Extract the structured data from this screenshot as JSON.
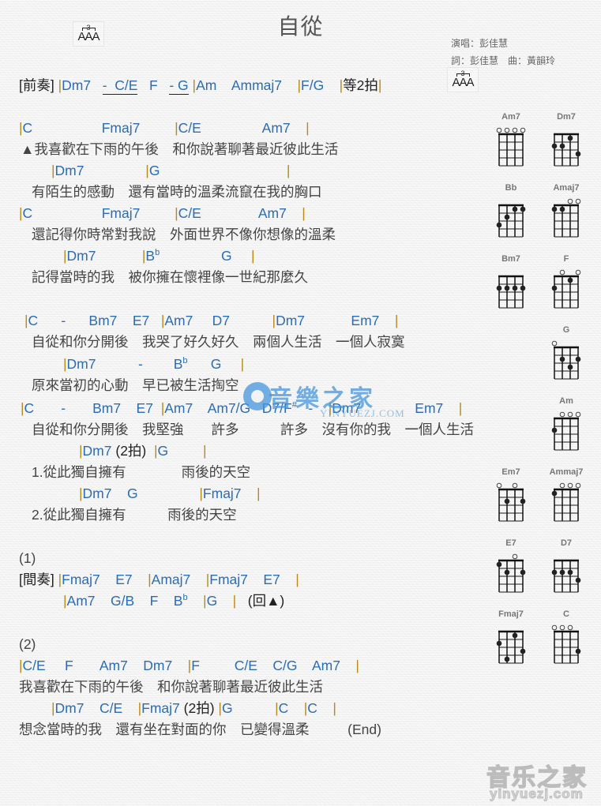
{
  "header": {
    "title": "自從",
    "symbol_three": "3",
    "symbol_aaa": "AAA",
    "singer": "演唱：彭佳慧",
    "writers": "詞：彭佳慧　曲：黃韻玲"
  },
  "intro": {
    "label": "[前奏]",
    "chords": [
      "Dm7",
      "-",
      "C/E",
      "F",
      "-",
      "G",
      "Am",
      "Ammaj7",
      "F/G"
    ],
    "wait": "等2拍"
  },
  "verse1": {
    "lines": [
      {
        "chords": [
          "C",
          "Fmaj7",
          "C/E",
          "Am7"
        ],
        "lyric": "▲我喜歡在下雨的午後　和你說著聊著最近彼此生活"
      },
      {
        "chords": [
          "Dm7",
          "G"
        ],
        "lyric": "有陌生的感動　還有當時的溫柔流竄在我的胸口"
      },
      {
        "chords": [
          "C",
          "Fmaj7",
          "C/E",
          "Am7"
        ],
        "lyric": "還記得你時常對我說　外面世界不像你想像的溫柔"
      },
      {
        "chords": [
          "Dm7",
          "B",
          "G"
        ],
        "chord_sup": "b",
        "lyric": "記得當時的我　被你擁在懷裡像一世紀那麼久"
      }
    ]
  },
  "chorus": {
    "lines": [
      {
        "chords": [
          "C",
          "-",
          "Bm7",
          "E7",
          "Am7",
          "D7",
          "Dm7",
          "Em7"
        ],
        "lyric": "自從和你分開後　我哭了好久好久　兩個人生活　一個人寂寞"
      },
      {
        "chords": [
          "Dm7",
          "-",
          "B",
          "G"
        ],
        "chord_sup": "b",
        "lyric": "原來當初的心動　早已被生活掏空"
      },
      {
        "chords": [
          "C",
          "-",
          "Bm7",
          "E7",
          "Am7",
          "Am7/G",
          "D7/F",
          "-",
          "Dm7",
          "Em7"
        ],
        "chord_sup": "#",
        "lyric_parts": [
          "自從和你分開後",
          "我堅強",
          "許多",
          "許多",
          "沒有你的我",
          "一個人生活"
        ]
      },
      {
        "chords": [
          "Dm7",
          "G"
        ],
        "beat": "(2拍)",
        "lyric_parts": [
          "1.從此獨自擁有",
          "雨後的天空"
        ]
      },
      {
        "chords": [
          "Dm7",
          "G",
          "Fmaj7"
        ],
        "lyric_parts": [
          "2.從此獨自擁有",
          "雨後的天空"
        ]
      }
    ]
  },
  "interlude": {
    "marker": "(1)",
    "label": "[間奏]",
    "line1": [
      "Fmaj7",
      "E7",
      "Amaj7",
      "Fmaj7",
      "E7"
    ],
    "line2": [
      "Am7",
      "G/B",
      "F",
      "B",
      "G"
    ],
    "line2_sup": "b",
    "back": "(回▲)"
  },
  "ending": {
    "marker": "(2)",
    "line1_chords": [
      "C/E",
      "F",
      "Am7",
      "Dm7",
      "F",
      "C/E",
      "C/G",
      "Am7"
    ],
    "line1_lyric": "我喜歡在下雨的午後　和你說著聊著最近彼此生活",
    "line2_chords": [
      "Dm7",
      "C/E",
      "Fmaj7",
      "G",
      "C",
      "C"
    ],
    "line2_beat": "(2拍)",
    "line2_lyric": "想念當時的我　還有坐在對面的你　已變得溫柔",
    "end": "(End)"
  },
  "watermark": {
    "cn": "音樂之家",
    "en": "YINYUEZJ.COM"
  },
  "footer_logo": {
    "cn": "音乐之家",
    "en": "yinyuezj.com"
  },
  "chord_diagrams": [
    {
      "name": "Am7",
      "open": [
        1,
        1,
        1,
        1
      ],
      "dots": []
    },
    {
      "name": "Dm7",
      "open": [
        0,
        0,
        0,
        0
      ],
      "dots": [
        [
          1,
          2
        ],
        [
          2,
          2
        ],
        [
          3,
          1
        ],
        [
          4,
          3
        ]
      ]
    },
    {
      "name": "Bb",
      "open": [
        0,
        0,
        0,
        0
      ],
      "dots": [
        [
          1,
          3
        ],
        [
          2,
          2
        ],
        [
          3,
          1
        ],
        [
          4,
          1
        ]
      ]
    },
    {
      "name": "Amaj7",
      "open": [
        0,
        0,
        1,
        1
      ],
      "dots": [
        [
          1,
          1
        ],
        [
          2,
          1
        ]
      ]
    },
    {
      "name": "Bm7",
      "open": [
        0,
        0,
        0,
        0
      ],
      "dots": [
        [
          1,
          2
        ],
        [
          2,
          2
        ],
        [
          3,
          2
        ],
        [
          4,
          2
        ]
      ]
    },
    {
      "name": "F",
      "open": [
        0,
        1,
        0,
        1
      ],
      "dots": [
        [
          1,
          2
        ],
        [
          3,
          1
        ]
      ]
    },
    {
      "name": "G",
      "open": [
        1,
        0,
        0,
        0
      ],
      "dots": [
        [
          2,
          2
        ],
        [
          3,
          3
        ],
        [
          4,
          2
        ]
      ]
    },
    {
      "name": "Am",
      "open": [
        0,
        1,
        1,
        1
      ],
      "dots": [
        [
          1,
          2
        ]
      ]
    },
    {
      "name": "Em7",
      "open": [
        1,
        0,
        1,
        0
      ],
      "dots": [
        [
          2,
          2
        ],
        [
          4,
          2
        ]
      ]
    },
    {
      "name": "Ammaj7",
      "open": [
        0,
        1,
        1,
        1
      ],
      "dots": [
        [
          1,
          1
        ]
      ]
    },
    {
      "name": "E7",
      "open": [
        0,
        0,
        1,
        0
      ],
      "dots": [
        [
          1,
          1
        ],
        [
          2,
          2
        ],
        [
          4,
          2
        ]
      ]
    },
    {
      "name": "D7",
      "open": [
        0,
        0,
        0,
        0
      ],
      "dots": [
        [
          1,
          2
        ],
        [
          2,
          2
        ],
        [
          3,
          2
        ],
        [
          4,
          3
        ]
      ]
    },
    {
      "name": "Fmaj7",
      "open": [
        0,
        0,
        0,
        0
      ],
      "dots": [
        [
          1,
          2
        ],
        [
          2,
          4
        ],
        [
          3,
          1
        ],
        [
          4,
          3
        ]
      ]
    },
    {
      "name": "C",
      "open": [
        1,
        1,
        1,
        0
      ],
      "dots": [
        [
          4,
          3
        ]
      ]
    }
  ]
}
